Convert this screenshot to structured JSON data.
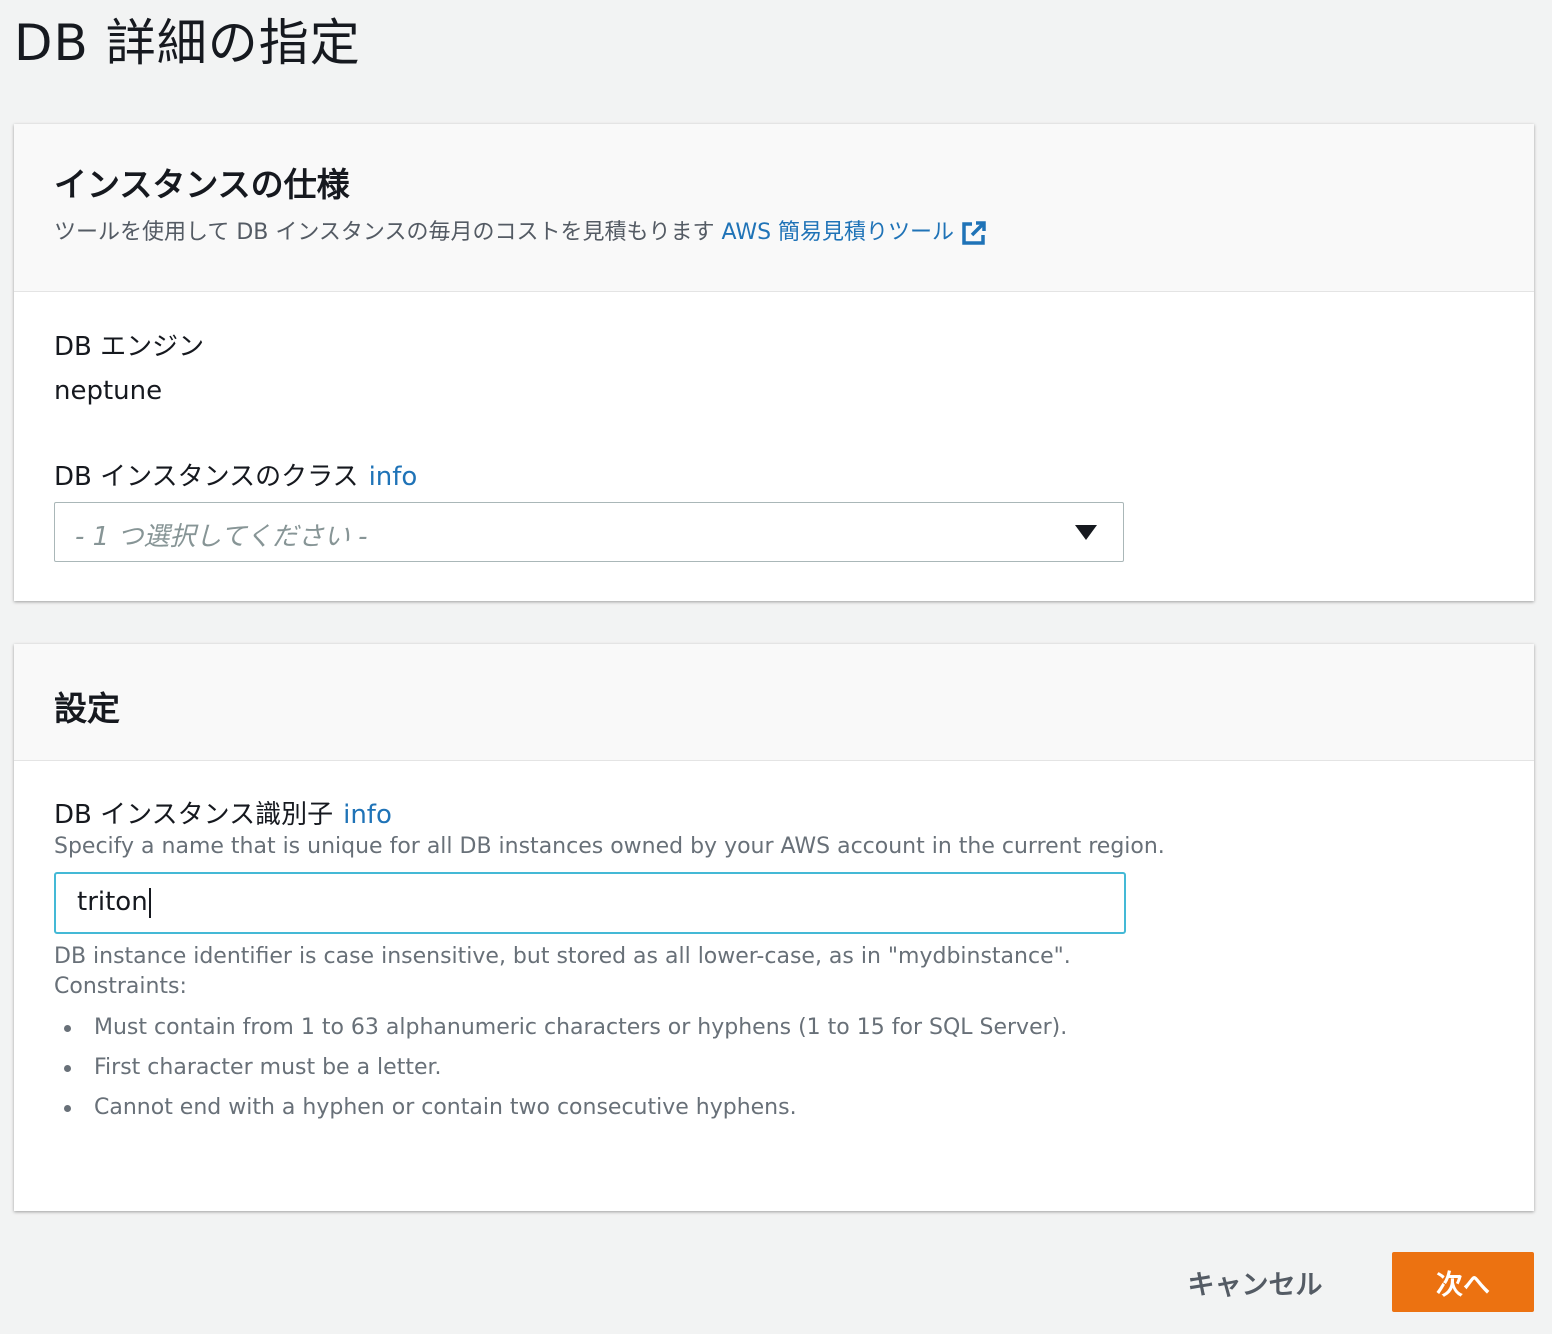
{
  "page": {
    "title": "DB 詳細の指定"
  },
  "instance_spec": {
    "title": "インスタンスの仕様",
    "description": "ツールを使用して DB インスタンスの毎月のコストを見積もります",
    "link_label": "AWS 簡易見積りツール",
    "engine_label": "DB エンジン",
    "engine_value": "neptune",
    "class_label": "DB インスタンスのクラス",
    "class_info": "info",
    "class_placeholder": "- 1 つ選択してください -"
  },
  "settings": {
    "title": "設定",
    "identifier_label": "DB インスタンス識別子",
    "identifier_info": "info",
    "identifier_description": "Specify a name that is unique for all DB instances owned by your AWS account in the current region.",
    "identifier_value": "triton",
    "case_note": "DB instance identifier is case insensitive, but stored as all lower-case, as in \"mydbinstance\".",
    "constraints_label": "Constraints:",
    "constraints": [
      "Must contain from 1 to 63 alphanumeric characters or hyphens (1 to 15 for SQL Server).",
      "First character must be a letter.",
      "Cannot end with a hyphen or contain two consecutive hyphens."
    ]
  },
  "footer": {
    "cancel_label": "キャンセル",
    "next_label": "次へ"
  },
  "colors": {
    "accent": "#ec7211",
    "link": "#1f73b7",
    "focus": "#44b9d6"
  }
}
